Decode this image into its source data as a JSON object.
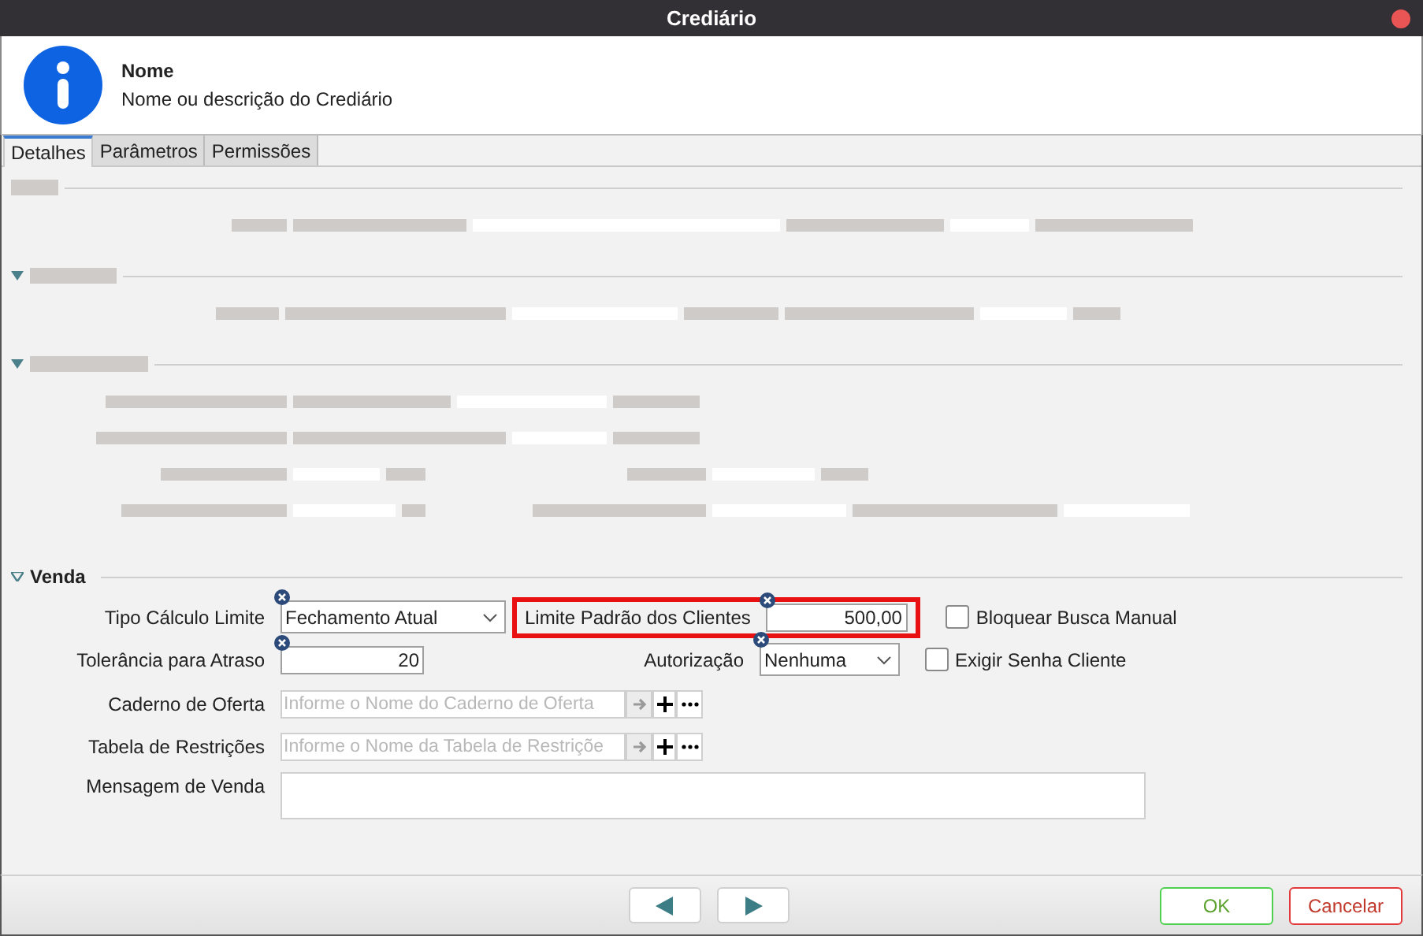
{
  "window": {
    "title": "Crediário"
  },
  "header": {
    "title": "Nome",
    "description": "Nome ou descrição do Crediário"
  },
  "tabs": [
    {
      "label": "Detalhes",
      "selected": true
    },
    {
      "label": "Parâmetros",
      "selected": false
    },
    {
      "label": "Permissões",
      "selected": false
    }
  ],
  "venda": {
    "title": "Venda",
    "expanded": true,
    "tipo_calculo_limite": {
      "label": "Tipo Cálculo Limite",
      "value": "Fechamento Atual"
    },
    "limite_padrao": {
      "label": "Limite Padrão dos Clientes",
      "value": "500,00",
      "highlighted": true
    },
    "bloquear_busca_manual": {
      "label": "Bloquear Busca Manual",
      "checked": false
    },
    "tolerancia": {
      "label": "Tolerância para Atraso",
      "value": "20"
    },
    "autorizacao": {
      "label": "Autorização",
      "value": "Nenhuma"
    },
    "exigir_senha": {
      "label": "Exigir Senha Cliente",
      "checked": false
    },
    "caderno": {
      "label": "Caderno de Oferta",
      "placeholder": "Informe o Nome do Caderno de Oferta"
    },
    "tabela": {
      "label": "Tabela de Restrições",
      "placeholder": "Informe o Nome da Tabela de Restriçõe"
    },
    "mensagem": {
      "label": "Mensagem de Venda"
    }
  },
  "buttons": [
    {
      "label": "OK",
      "kind": "ok"
    },
    {
      "label": "Cancelar",
      "kind": "cancel"
    }
  ]
}
